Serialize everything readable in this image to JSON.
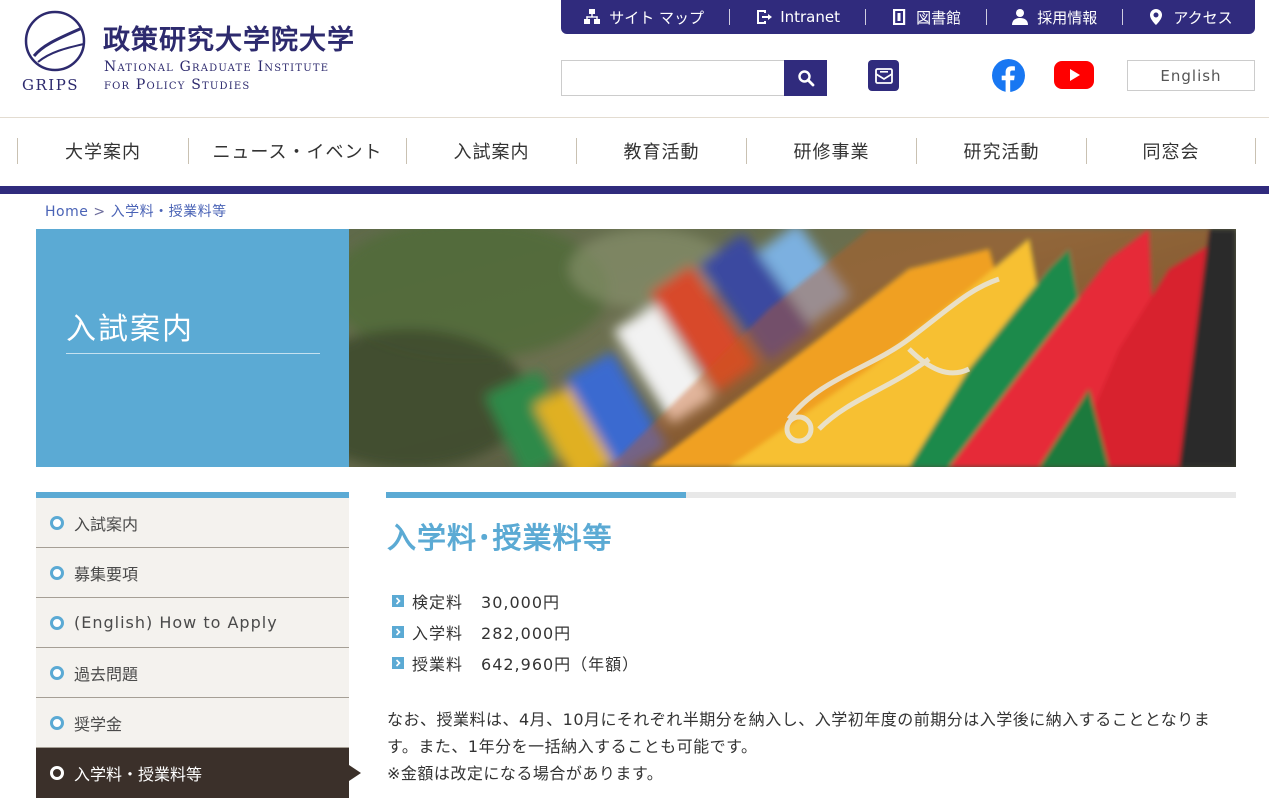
{
  "header": {
    "logo_jp": "政策研究大学院大学",
    "logo_en_line1": "National Graduate Institute",
    "logo_en_line2": "for Policy Studies",
    "logo_abbr": "GRIPS",
    "utility_links": [
      {
        "label": "サイト マップ",
        "icon": "sitemap-icon"
      },
      {
        "label": "Intranet",
        "icon": "intranet-icon"
      },
      {
        "label": "図書館",
        "icon": "library-icon"
      },
      {
        "label": "採用情報",
        "icon": "person-icon"
      },
      {
        "label": "アクセス",
        "icon": "location-pin-icon"
      }
    ],
    "search": {
      "value": "",
      "placeholder": ""
    },
    "language_button": "English"
  },
  "global_nav": [
    "大学案内",
    "ニュース・イベント",
    "入試案内",
    "教育活動",
    "研修事業",
    "研究活動",
    "同窓会"
  ],
  "breadcrumb": {
    "home": "Home",
    "separator": ">",
    "current": "入学料・授業料等"
  },
  "hero": {
    "section_title": "入試案内"
  },
  "side_nav": [
    {
      "label": "入試案内",
      "active": false
    },
    {
      "label": "募集要項",
      "active": false
    },
    {
      "label": "(English) How to Apply",
      "active": false
    },
    {
      "label": "過去問題",
      "active": false
    },
    {
      "label": "奨学金",
      "active": false
    },
    {
      "label": "入学料・授業料等",
      "active": true
    }
  ],
  "main": {
    "title": "入学料･授業料等",
    "fees": [
      {
        "name": "検定料",
        "amount": "30,000円"
      },
      {
        "name": "入学料",
        "amount": "282,000円"
      },
      {
        "name": "授業料",
        "amount": "642,960円（年額）"
      }
    ],
    "paragraph_line1": "なお、授業料は、4月、10月にそれぞれ半期分を納入し、入学初年度の前期分は入学後に納入することとなります。また、1年分を一括納入することも可能です。",
    "paragraph_line2": "※金額は改定になる場合があります。"
  },
  "colors": {
    "brand_navy": "#302b7d",
    "accent_blue": "#5baad4",
    "active_dark": "#3b302a"
  }
}
